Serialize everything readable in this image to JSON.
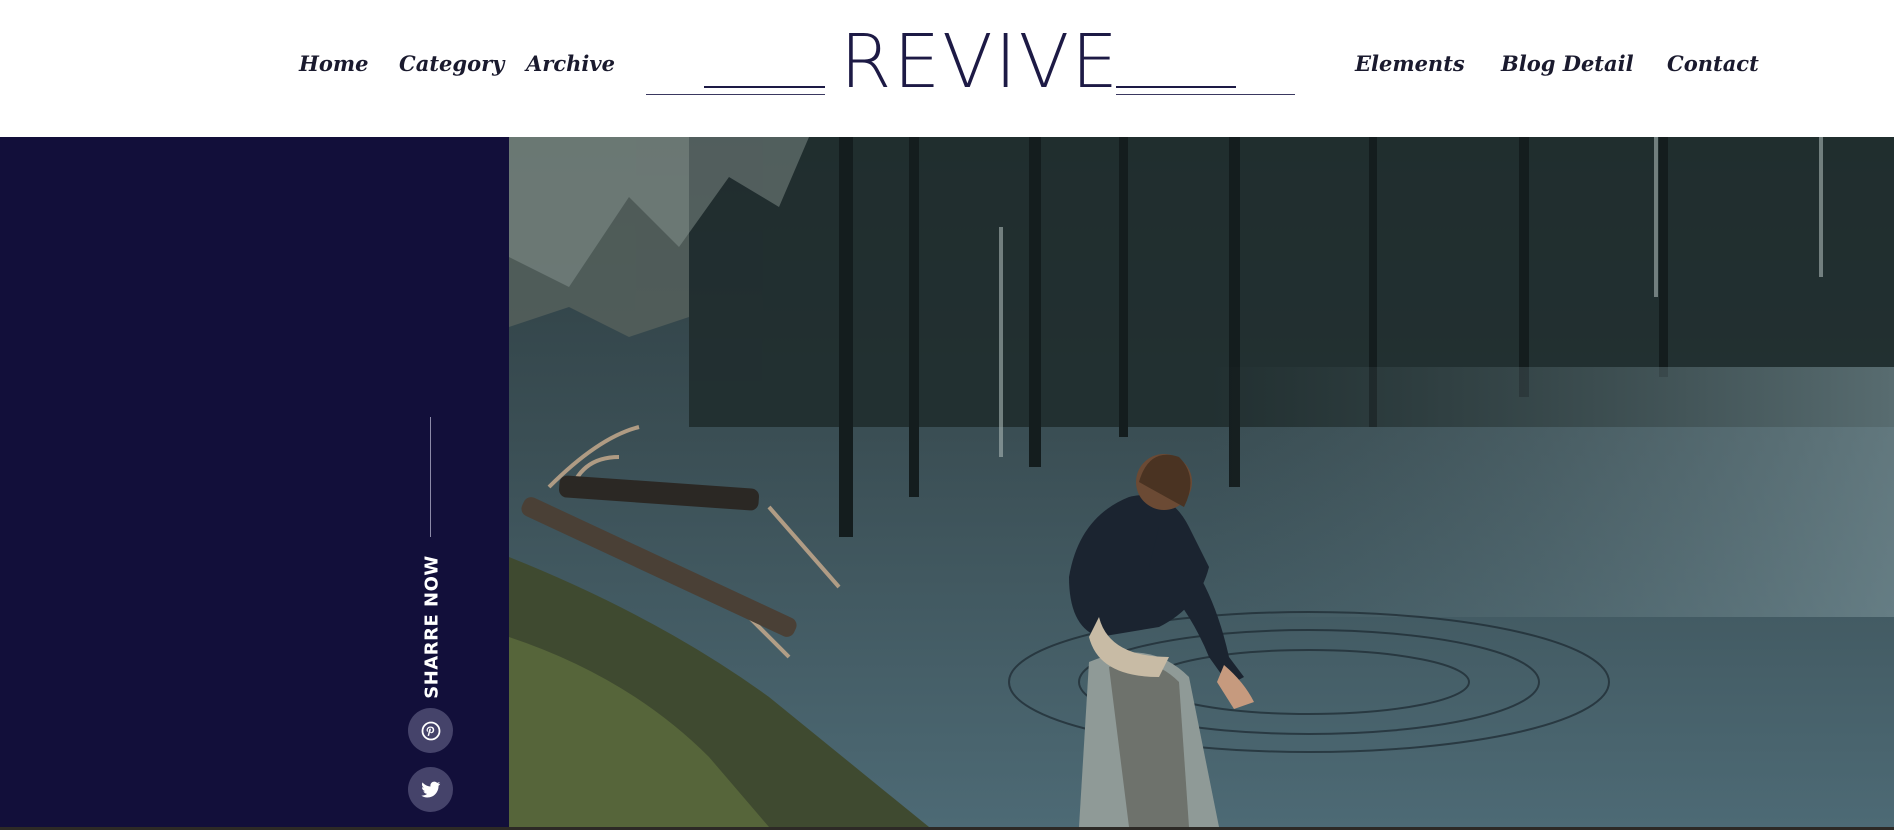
{
  "nav": {
    "left": [
      "Home",
      "Category",
      "Archive"
    ],
    "right": [
      "Elements",
      "Blog Detail",
      "Contact"
    ]
  },
  "logo": {
    "text": "REVIVE"
  },
  "sidebar": {
    "share_label": "SHARRE NOW",
    "social": [
      {
        "icon": "pinterest-icon"
      },
      {
        "icon": "twitter-icon"
      }
    ]
  },
  "hero": {
    "description_icon": "lake-photo"
  },
  "colors": {
    "sidebar_bg": "#120f3a",
    "logo": "#1d1a45",
    "nav_text": "#1a1a2e",
    "social_btn": "#45436a"
  }
}
